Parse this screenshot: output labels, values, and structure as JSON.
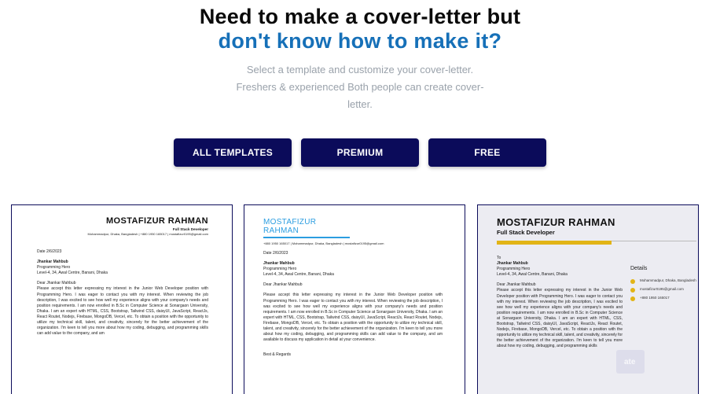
{
  "hero": {
    "title_line1": "Need to make a cover-letter but",
    "title_line2": "don't know how to make it?",
    "subtitle": "Select a template and customize your cover-letter. Freshers & experienced Both people can create cover-letter."
  },
  "tabs": [
    {
      "label": "ALL TEMPLATES"
    },
    {
      "label": "PREMIUM"
    },
    {
      "label": "FREE"
    }
  ],
  "cards": [
    {
      "name": "MOSTAFIZUR RAHMAN",
      "role": "Full Stack Developer",
      "contact": "Mohammadpur, Dhaka, Bangladesh | +880 1950 165017 | mostafizur0195@gmail.com",
      "date": "Date 2/6/2023",
      "recipient": "Jhankar Mahbub",
      "company": "Programming Hero",
      "address": "Level-4, 34, Awal Centre, Banani, Dhaka",
      "greeting": "Dear Jhankar Mahbub",
      "body": "Please accept this letter expressing my interest in the Junior Web Developer position with Programming Hero. I was eager to contact you with my interest. When reviewing the job description, I was excited to see how well my experience aligns with your company's needs and position requirements. I am now enrolled in B.Sc in Computer Science at Sonargaon University, Dhaka. I am an expert with HTML, CSS, Bootstrap, Tailwind CSS, daisyUI, JavaScript, ReactJs, React Routet, Nodejs, Firebase, MongoDB, Vercel, etc. To obtain a position with the opportunity to utilize my technical skill, talent, and creativity, sincerely for the better achievement of the organization. I'm keen to tell you more about how my coding, debugging, and programming skills can add value to the company, and am"
    },
    {
      "name_line1": "MOSTAFIZUR",
      "name_line2": "RAHMAN",
      "contact": "+880 1950 165017 | Mohammadpur, Dhaka, Bangladesh | mostafizur0195@gmail.com",
      "date": "Date 2/6/2023",
      "recipient": "Jhankar Mahbub",
      "company": "Programming Hero",
      "address": "Level-4, 34, Awal Centre, Banani, Dhaka",
      "greeting": "Dear Jhankar Mahbub",
      "body": "Please accept this letter expressing my interest in the Junior Web Developer position with Programming Hero. I was eager to contact you with my interest. When reviewing the job description, I was excited to see how well my experience aligns with your company's needs and position requirements. I am now enrolled in B.Sc in Computer Science at Sonargaon University, Dhaka. I am an expert with HTML, CSS, Bootstrap, Tailwind CSS, daisyUI, JavaScript, ReactJs, React Routet, Nodejs, Firebase, MongoDB, Vercel, etc. To obtain a position with the opportunity to utilize my technical skill, talent, and creativity, sincerely for the better achievement of the organization. I'm keen to tell you more about how my coding, debugging, and programming skills can add value to the company, and am available to discuss my application in detail at your convenience.",
      "closing": "Best & Regards"
    },
    {
      "name": "MOSTAFIZUR RAHMAN",
      "role": "Full Stack Developer",
      "to": "To",
      "recipient": "Jhankar Mahbub",
      "company": "Programming Hero",
      "address": "Level-4, 34, Awal Centre, Banani, Dhaka",
      "greeting": "Dear Jhankar Mahbub",
      "body": "Please accept this letter expressing my interest in the Junior Web Developer position with Programming Hero. I was eager to contact you with my interest. When reviewing the job description, I was excited to see how well my experience aligns with your company's needs and position requirements. I am now enrolled in B.Sc in Computer Science at Sonargaon University, Dhaka. I am an expert with HTML, CSS, Bootstrap, Tailwind CSS, daisyUI, JavaScript, ReactJs, React Routet, Nodejs, Firebase, MongoDB, Vercel, etc. To obtain a position with the opportunity to utilize my technical skill, talent, and creativity, sincerely for the better achievement of the organization. I'm keen to tell you more about how my coding, debugging, and programming skills",
      "details_heading": "Details",
      "details": {
        "address": "Mohammadpur, Dhaka, Bangladesh",
        "email": "mostafizur0195@gmail.com",
        "phone": "+880 1950 165017"
      },
      "overlay_text": "ate"
    }
  ],
  "colors": {
    "accent_blue": "#1670b8",
    "button_navy": "#0b0b5a",
    "template_blue": "#2b9de0",
    "template_gold": "#e2b416"
  }
}
